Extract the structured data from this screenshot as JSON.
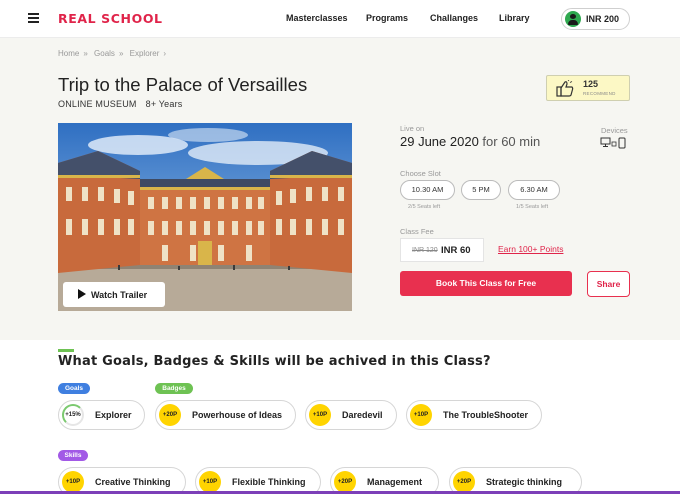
{
  "header": {
    "logo": "REAL SCHOOL",
    "nav": [
      "Masterclasses",
      "Programs",
      "Challanges",
      "Library"
    ],
    "wallet": "INR 200"
  },
  "breadcrumb": [
    "Home",
    "Goals",
    "Explorer"
  ],
  "course": {
    "title": "Trip to the Palace of Versailles",
    "category": "ONLINE MUSEUM",
    "age": "8+ Years",
    "recommend_count": "125",
    "recommend_label": "RECOMMEND",
    "watch_label": "Watch Trailer"
  },
  "schedule": {
    "live_label": "Live on",
    "date": "29 June 2020",
    "duration": "for 60 min",
    "devices_label": "Devices",
    "slot_label": "Choose Slot",
    "slots": [
      {
        "time": "10.30 AM",
        "seats": "2/5 Seats left"
      },
      {
        "time": "5 PM",
        "seats": ""
      },
      {
        "time": "6.30 AM",
        "seats": "1/5 Seats left"
      }
    ],
    "fee_label": "Class Fee",
    "fee_old": "INR 120",
    "fee_new": "INR 60",
    "earn": "Earn 100+ Points",
    "book": "Book This Class for Free",
    "share": "Share"
  },
  "goals_section": {
    "title": "What Goals, Badges & Skills will be achived in this Class?",
    "tags": {
      "goals": "Goals",
      "badges": "Badges",
      "skills": "Skills"
    },
    "row1": [
      {
        "badge": "+15%",
        "label": "Explorer"
      },
      {
        "badge": "+20P",
        "label": "Powerhouse of Ideas"
      },
      {
        "badge": "+10P",
        "label": "Daredevil"
      },
      {
        "badge": "+10P",
        "label": "The TroubleShooter"
      }
    ],
    "row2": [
      {
        "badge": "+10P",
        "label": "Creative Thinking"
      },
      {
        "badge": "+10P",
        "label": "Flexible Thinking"
      },
      {
        "badge": "+20P",
        "label": "Management"
      },
      {
        "badge": "+20P",
        "label": "Strategic thinking"
      }
    ]
  },
  "colors": {
    "brand": "#e0244a",
    "goals_tag": "#3f7fe0",
    "badges_tag": "#6ec253",
    "skills_tag": "#a259e6",
    "point_badge": "#ffd400"
  }
}
